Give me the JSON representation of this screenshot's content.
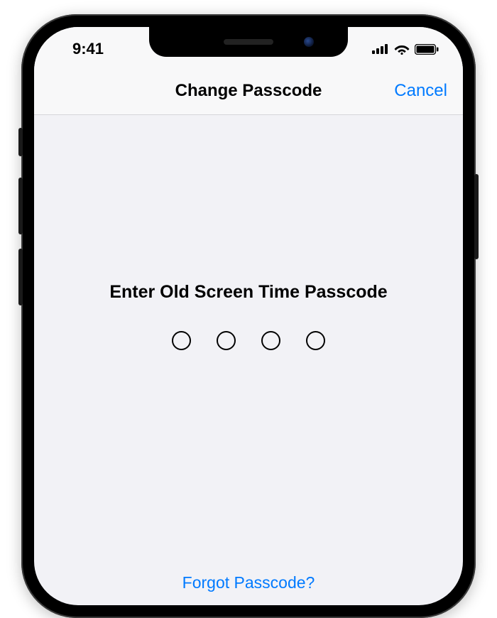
{
  "statusbar": {
    "time": "9:41"
  },
  "navbar": {
    "title": "Change Passcode",
    "cancel": "Cancel"
  },
  "prompt": "Enter Old Screen Time Passcode",
  "forgot": "Forgot Passcode?",
  "passcode": {
    "length": 4,
    "entered": 0
  }
}
